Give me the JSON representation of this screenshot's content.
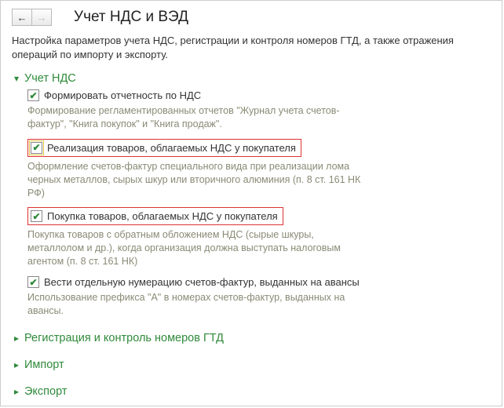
{
  "header": {
    "title": "Учет НДС и ВЭД"
  },
  "intro": "Настройка параметров учета НДС, регистрации и контроля номеров ГТД, а также отражения операций по импорту и экспорту.",
  "sections": {
    "vat": {
      "title": "Учет НДС",
      "expanded": true,
      "items": [
        {
          "label": "Формировать отчетность по НДС",
          "checked": true,
          "desc": "Формирование регламентированных отчетов \"Журнал учета счетов-фактур\", \"Книга покупок\" и \"Книга продаж\"."
        },
        {
          "label": "Реализация товаров, облагаемых НДС у покупателя",
          "checked": true,
          "highlight": "red+yellow",
          "desc": "Оформление счетов-фактур специального вида при реализации лома черных металлов, сырых шкур или вторичного алюминия (п. 8 ст. 161 НК РФ)"
        },
        {
          "label": "Покупка товаров, облагаемых НДС у покупателя",
          "checked": true,
          "highlight": "red",
          "desc": "Покупка товаров с обратным обложением НДС (сырые шкуры, металлолом и др.), когда организация должна выступать налоговым агентом (п. 8 ст. 161 НК)"
        },
        {
          "label": "Вести отдельную нумерацию счетов-фактур, выданных на авансы",
          "checked": true,
          "desc": "Использование префикса \"А\" в номерах счетов-фактур, выданных на авансы."
        }
      ]
    },
    "gtd": {
      "title": "Регистрация и контроль номеров ГТД",
      "expanded": false
    },
    "import": {
      "title": "Импорт",
      "expanded": false
    },
    "export": {
      "title": "Экспорт",
      "expanded": false
    }
  }
}
